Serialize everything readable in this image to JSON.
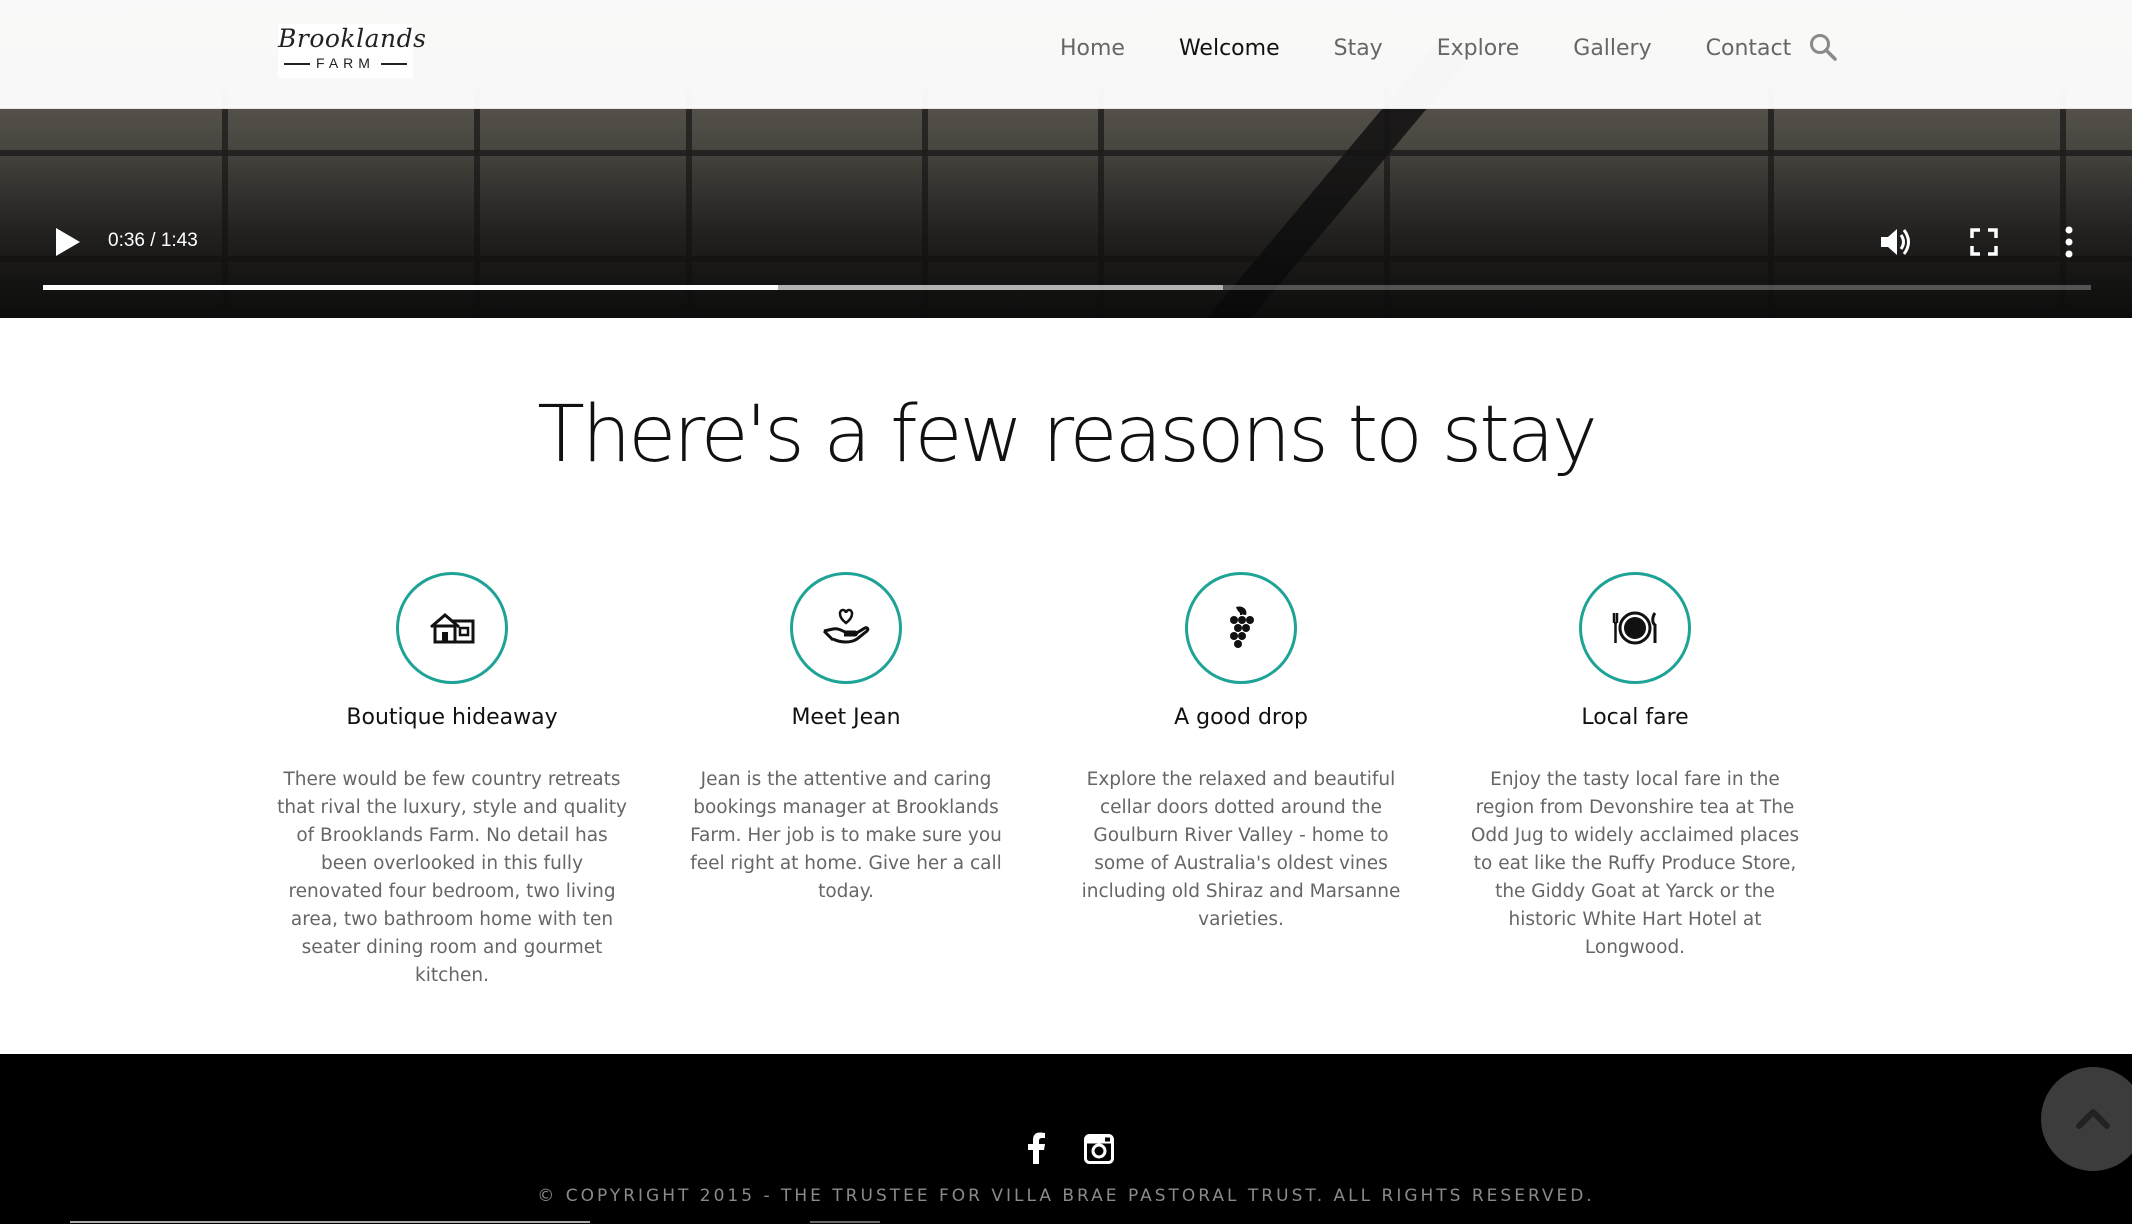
{
  "header": {
    "logo": {
      "script": "Brooklands",
      "sub": "FARM"
    },
    "nav": [
      {
        "label": "Home",
        "active": false
      },
      {
        "label": "Welcome",
        "active": true
      },
      {
        "label": "Stay",
        "active": false
      },
      {
        "label": "Explore",
        "active": false
      },
      {
        "label": "Gallery",
        "active": false
      },
      {
        "label": "Contact",
        "active": false
      }
    ],
    "search_icon": "search-icon"
  },
  "video": {
    "time": "0:36 / 1:43",
    "played_fraction": 0.359,
    "buffered_fraction": 0.576,
    "controls": [
      "play-icon",
      "volume-icon",
      "fullscreen-icon",
      "more-options-icon"
    ]
  },
  "reasons": {
    "headline": "There's a few reasons to stay",
    "accent_color": "#1fa397",
    "items": [
      {
        "icon": "house-icon",
        "title": "Boutique hideaway",
        "text": "There would be few country retreats that rival the luxury, style and quality of Brooklands Farm. No detail has been overlooked in this fully renovated four bedroom, two living area, two bathroom home with ten seater dining room and gourmet kitchen."
      },
      {
        "icon": "heart-hand-icon",
        "title": "Meet Jean",
        "text": "Jean is the attentive and caring bookings manager at Brooklands Farm. Her job is to make sure you feel right at home. Give her a call today."
      },
      {
        "icon": "grapes-icon",
        "title": "A good drop",
        "text": "Explore the relaxed and beautiful cellar doors dotted around the Goulburn River Valley - home to some of Australia's oldest vines including old Shiraz and Marsanne varieties."
      },
      {
        "icon": "plate-cutlery-icon",
        "title": "Local fare",
        "text": "Enjoy the tasty local fare in the region from Devonshire tea at The Odd Jug to widely acclaimed places to eat like the Ruffy Produce Store, the Giddy Goat at Yarck or the historic White Hart Hotel at Longwood."
      }
    ]
  },
  "footer": {
    "social": [
      "facebook-icon",
      "instagram-icon"
    ],
    "copyright": "© COPYRIGHT 2015 - THE TRUSTEE FOR VILLA BRAE PASTORAL TRUST. ALL RIGHTS RESERVED.",
    "back_to_top_icon": "chevron-up-icon"
  }
}
